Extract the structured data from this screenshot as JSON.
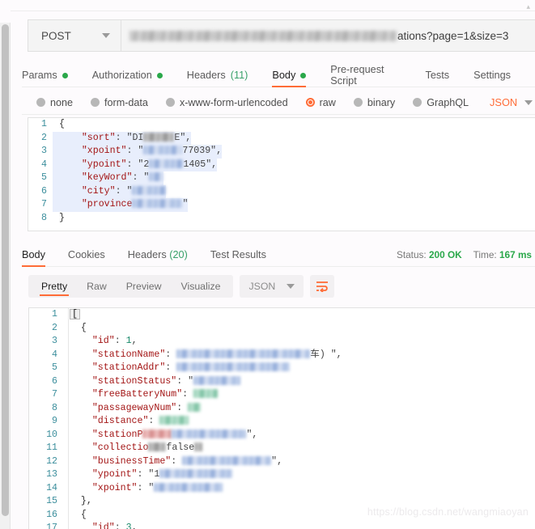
{
  "window": {
    "watermark": "https://blog.csdn.net/wangmiaoyan"
  },
  "request": {
    "method": "POST",
    "url_visible_tail": "ations?page=1&size=3",
    "url_redacted": true,
    "tabs": [
      {
        "label": "Params",
        "dot": true,
        "count": null,
        "active": false
      },
      {
        "label": "Authorization",
        "dot": true,
        "count": null,
        "active": false
      },
      {
        "label": "Headers",
        "dot": false,
        "count": "(11)",
        "active": false
      },
      {
        "label": "Body",
        "dot": true,
        "count": null,
        "active": true
      },
      {
        "label": "Pre-request Script",
        "dot": false,
        "count": null,
        "active": false
      },
      {
        "label": "Tests",
        "dot": false,
        "count": null,
        "active": false
      },
      {
        "label": "Settings",
        "dot": false,
        "count": null,
        "active": false
      }
    ],
    "body_types": [
      {
        "label": "none",
        "selected": false
      },
      {
        "label": "form-data",
        "selected": false
      },
      {
        "label": "x-www-form-urlencoded",
        "selected": false
      },
      {
        "label": "raw",
        "selected": true
      },
      {
        "label": "binary",
        "selected": false
      },
      {
        "label": "GraphQL",
        "selected": false
      }
    ],
    "raw_format": "JSON",
    "body_lines": [
      {
        "n": "1",
        "text": "{"
      },
      {
        "n": "2",
        "key": "\"sort\"",
        "prefix": ": \"DI",
        "suffix": "E\","
      },
      {
        "n": "3",
        "key": "\"xpoint\"",
        "prefix": ": \"",
        "suffix": "77039\","
      },
      {
        "n": "4",
        "key": "\"ypoint\"",
        "prefix": ": \"2",
        "suffix": "1405\","
      },
      {
        "n": "5",
        "key": "\"keyWord\"",
        "prefix": ": \"",
        "suffix": ""
      },
      {
        "n": "6",
        "key": "\"city\"",
        "prefix": ": \"",
        "suffix": ""
      },
      {
        "n": "7",
        "key": "\"province",
        "prefix": "",
        "suffix": "\""
      },
      {
        "n": "8",
        "text": "}"
      }
    ]
  },
  "response": {
    "tabs": [
      {
        "label": "Body",
        "count": null,
        "active": true
      },
      {
        "label": "Cookies",
        "count": null,
        "active": false
      },
      {
        "label": "Headers",
        "count": "(20)",
        "active": false
      },
      {
        "label": "Test Results",
        "count": null,
        "active": false
      }
    ],
    "status_label": "Status:",
    "status_value": "200 OK",
    "time_label": "Time:",
    "time_value": "167 ms",
    "view_modes": [
      {
        "label": "Pretty",
        "active": true
      },
      {
        "label": "Raw",
        "active": false
      },
      {
        "label": "Preview",
        "active": false
      },
      {
        "label": "Visualize",
        "active": false
      }
    ],
    "format": "JSON",
    "wrap_icon": "wrap-lines-icon",
    "body_lines": [
      {
        "n": "1",
        "kind": "bracket",
        "text": "["
      },
      {
        "n": "2",
        "kind": "plain",
        "text": "{",
        "indent": 1
      },
      {
        "n": "3",
        "kind": "kv",
        "key": "\"id\"",
        "value": "1",
        "value_type": "num",
        "indent": 2,
        "trail": ","
      },
      {
        "n": "4",
        "kind": "blur",
        "key": "\"stationName\"",
        "blur": "blue",
        "width": 165,
        "tail": "车) \",",
        "indent": 2
      },
      {
        "n": "5",
        "kind": "blur",
        "key": "\"stationAddr\"",
        "blur": "blue",
        "width": 140,
        "tail": "",
        "indent": 2
      },
      {
        "n": "6",
        "kind": "blur",
        "key": "\"stationStatus\"",
        "blur": "blue",
        "width": 58,
        "tail": "",
        "indent": 2
      },
      {
        "n": "7",
        "kind": "blur",
        "key": "\"freeBatteryNum\"",
        "blur": "green",
        "width": 30,
        "tail": "",
        "indent": 2
      },
      {
        "n": "8",
        "kind": "blur",
        "key": "\"passagewayNum\"",
        "blur": "green",
        "width": 16,
        "tail": "",
        "indent": 2
      },
      {
        "n": "9",
        "kind": "blur",
        "key": "\"distance\"",
        "blur": "green",
        "width": 36,
        "tail": "",
        "indent": 2
      },
      {
        "n": "10",
        "kind": "blur",
        "key": "\"stationP",
        "blur": "red",
        "width": 120,
        "tail": "\",",
        "indent": 2
      },
      {
        "n": "11",
        "kind": "blur",
        "key": "\"collectio",
        "blur": "gray",
        "width": 52,
        "tail": "",
        "indent": 2
      },
      {
        "n": "12",
        "kind": "blur",
        "key": "\"businessTime\"",
        "blur": "blue",
        "width": 110,
        "tail": "\",",
        "indent": 2
      },
      {
        "n": "13",
        "kind": "blur",
        "key": "\"ypoint\"",
        "blur": "blue",
        "width": 90,
        "tail": "",
        "indent": 2
      },
      {
        "n": "14",
        "kind": "blur",
        "key": "\"xpoint\"",
        "blur": "blue",
        "width": 85,
        "tail": "",
        "indent": 2
      },
      {
        "n": "15",
        "kind": "plain",
        "text": "},",
        "indent": 1
      },
      {
        "n": "16",
        "kind": "plain",
        "text": "{",
        "indent": 1
      },
      {
        "n": "17",
        "kind": "kv",
        "key": "\"id\"",
        "value": "3",
        "value_type": "num",
        "indent": 2,
        "trail": ","
      }
    ]
  }
}
